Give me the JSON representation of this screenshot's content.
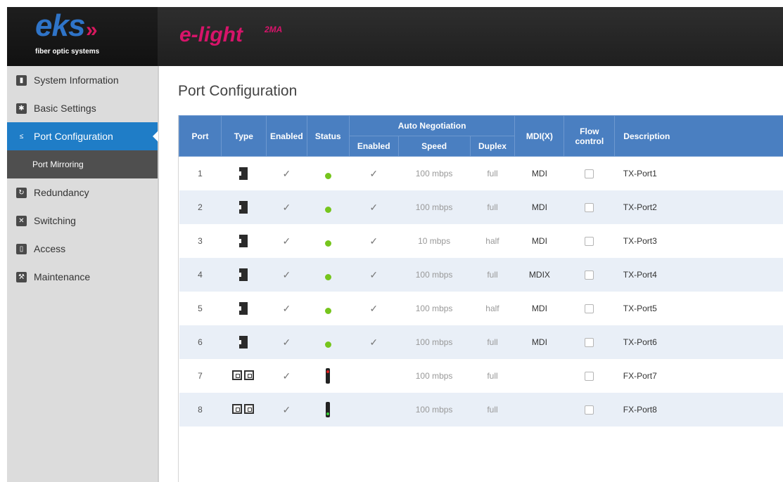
{
  "header": {
    "brand_name": "eks",
    "brand_arrows": "»",
    "brand_tagline": "fiber optic systems",
    "product_name": "e-light",
    "product_sup": "2MA"
  },
  "sidebar": {
    "items": [
      {
        "label": "System Information",
        "icon": "bar-chart-icon"
      },
      {
        "label": "Basic Settings",
        "icon": "gear-icon"
      },
      {
        "label": "Port Configuration",
        "icon": "port-config-icon",
        "active": true
      },
      {
        "label": "Port Mirroring",
        "sub": true
      },
      {
        "label": "Redundancy",
        "icon": "redundancy-icon"
      },
      {
        "label": "Switching",
        "icon": "shuffle-icon"
      },
      {
        "label": "Access",
        "icon": "lock-icon"
      },
      {
        "label": "Maintenance",
        "icon": "wrench-icon"
      }
    ]
  },
  "main": {
    "title": "Port Configuration",
    "table": {
      "headers": {
        "port": "Port",
        "type": "Type",
        "enabled": "Enabled",
        "status": "Status",
        "auto_negotiation": "Auto Negotiation",
        "an_enabled": "Enabled",
        "speed": "Speed",
        "duplex": "Duplex",
        "mdi": "MDI(X)",
        "flow_control": "Flow control",
        "description": "Description"
      },
      "rows": [
        {
          "port": "1",
          "type": "copper",
          "enabled": true,
          "status": "green-dot",
          "an_enabled": true,
          "speed": "100 mbps",
          "duplex": "full",
          "mdi": "MDI",
          "flow": false,
          "description": "TX-Port1"
        },
        {
          "port": "2",
          "type": "copper",
          "enabled": true,
          "status": "green-dot",
          "an_enabled": true,
          "speed": "100 mbps",
          "duplex": "full",
          "mdi": "MDI",
          "flow": false,
          "description": "TX-Port2"
        },
        {
          "port": "3",
          "type": "copper",
          "enabled": true,
          "status": "green-dot",
          "an_enabled": true,
          "speed": "10 mbps",
          "duplex": "half",
          "mdi": "MDI",
          "flow": false,
          "description": "TX-Port3"
        },
        {
          "port": "4",
          "type": "copper",
          "enabled": true,
          "status": "green-dot",
          "an_enabled": true,
          "speed": "100 mbps",
          "duplex": "full",
          "mdi": "MDIX",
          "flow": false,
          "description": "TX-Port4"
        },
        {
          "port": "5",
          "type": "copper",
          "enabled": true,
          "status": "green-dot",
          "an_enabled": true,
          "speed": "100 mbps",
          "duplex": "half",
          "mdi": "MDI",
          "flow": false,
          "description": "TX-Port5"
        },
        {
          "port": "6",
          "type": "copper",
          "enabled": true,
          "status": "green-dot",
          "an_enabled": true,
          "speed": "100 mbps",
          "duplex": "full",
          "mdi": "MDI",
          "flow": false,
          "description": "TX-Port6"
        },
        {
          "port": "7",
          "type": "fiber",
          "enabled": true,
          "status": "red-light",
          "an_enabled": null,
          "speed": "100 mbps",
          "duplex": "full",
          "mdi": "",
          "flow": false,
          "description": "FX-Port7"
        },
        {
          "port": "8",
          "type": "fiber",
          "enabled": true,
          "status": "green-light",
          "an_enabled": null,
          "speed": "100 mbps",
          "duplex": "full",
          "mdi": "",
          "flow": false,
          "description": "FX-Port8"
        }
      ]
    }
  },
  "colors": {
    "header_bg": "#262626",
    "brand_blue": "#2f74c8",
    "brand_magenta": "#d7146a",
    "sidebar_bg": "#dcdcdc",
    "active_blue": "#1f7dc7",
    "table_header": "#4a7fc1",
    "row_alt": "#e9eff7"
  }
}
